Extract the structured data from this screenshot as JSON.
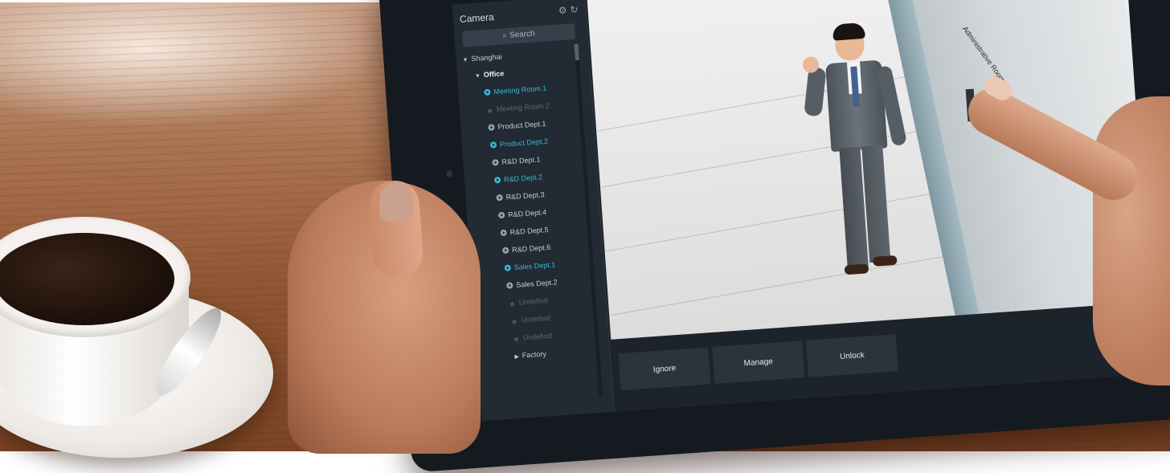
{
  "sidebar": {
    "title": "Camera",
    "search_placeholder": "Search",
    "icons": {
      "settings": "gear-icon",
      "refresh": "refresh-icon"
    },
    "tree": [
      {
        "label": "Shanghai",
        "kind": "group",
        "state": "expanded"
      },
      {
        "label": "Office",
        "kind": "group",
        "state": "expanded"
      },
      {
        "label": "Meeting Room 1",
        "kind": "camera",
        "state": "active"
      },
      {
        "label": "Meeting Room 2",
        "kind": "camera",
        "state": "disabled"
      },
      {
        "label": "Product Dept.1",
        "kind": "camera",
        "state": "normal"
      },
      {
        "label": "Product Dept.2",
        "kind": "camera",
        "state": "active"
      },
      {
        "label": "R&D Dept.1",
        "kind": "camera",
        "state": "normal"
      },
      {
        "label": "R&D Dept.2",
        "kind": "camera",
        "state": "active"
      },
      {
        "label": "R&D Dept.3",
        "kind": "camera",
        "state": "normal"
      },
      {
        "label": "R&D Dept.4",
        "kind": "camera",
        "state": "normal"
      },
      {
        "label": "R&D Dept.5",
        "kind": "camera",
        "state": "normal"
      },
      {
        "label": "R&D Dept.6",
        "kind": "camera",
        "state": "normal"
      },
      {
        "label": "Sales Dept.1",
        "kind": "camera",
        "state": "active"
      },
      {
        "label": "Sales Dept.2",
        "kind": "camera",
        "state": "normal"
      },
      {
        "label": "Undefind",
        "kind": "camera",
        "state": "disabled"
      },
      {
        "label": "Undefind",
        "kind": "camera",
        "state": "disabled"
      },
      {
        "label": "Undefind",
        "kind": "camera",
        "state": "disabled"
      },
      {
        "label": "Factory",
        "kind": "group",
        "state": "collapsed"
      }
    ]
  },
  "video": {
    "door_sign": "Administrative Room"
  },
  "actions": {
    "ignore": "Ignore",
    "manage": "Manage",
    "unlock": "Unlock"
  },
  "colors": {
    "accent": "#3ab7d6",
    "panel": "#222a33",
    "button": "#2b343d"
  }
}
